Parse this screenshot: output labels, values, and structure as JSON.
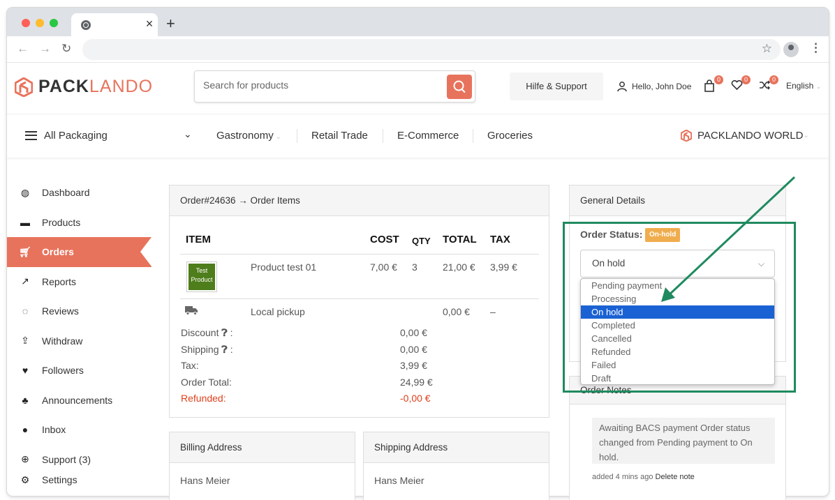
{
  "browser": {
    "tab_close": "×",
    "new_tab": "+"
  },
  "header": {
    "logo_text_dark": "PACK",
    "logo_text_accent": "LANDO",
    "search_placeholder": "Search for products",
    "support_label": "Hilfe & Support",
    "greeting": "Hello, John Doe",
    "cart_count": "0",
    "wishlist_count": "0",
    "compare_count": "0",
    "language": "English"
  },
  "categories": {
    "all_label": "All Packaging",
    "items": [
      "Gastronomy",
      "Retail Trade",
      "E-Commerce",
      "Groceries"
    ],
    "world_label": "PACKLANDO WORLD"
  },
  "sidebar": {
    "items": [
      {
        "label": "Dashboard",
        "icon": "dashboard-icon"
      },
      {
        "label": "Products",
        "icon": "briefcase-icon"
      },
      {
        "label": "Orders",
        "icon": "cart-icon"
      },
      {
        "label": "Reports",
        "icon": "chart-icon"
      },
      {
        "label": "Reviews",
        "icon": "comments-icon"
      },
      {
        "label": "Withdraw",
        "icon": "upload-icon"
      },
      {
        "label": "Followers",
        "icon": "heart-icon"
      },
      {
        "label": "Announcements",
        "icon": "bell-icon"
      },
      {
        "label": "Inbox",
        "icon": "chat-bubble-icon"
      },
      {
        "label": "Support (3)",
        "icon": "lifebuoy-icon"
      },
      {
        "label": "Settings",
        "icon": "gear-icon"
      }
    ]
  },
  "order": {
    "title": "Order#24636 → Order Items",
    "columns": {
      "item": "ITEM",
      "cost": "COST",
      "qty": "QTY",
      "total": "TOTAL",
      "tax": "TAX"
    },
    "product": {
      "image_text": "Test Product",
      "name": "Product test 01",
      "cost": "7,00 €",
      "qty": "3",
      "total": "21,00 €",
      "tax": "3,99 €"
    },
    "shipping_line": {
      "name": "Local pickup",
      "total": "0,00 €",
      "tax": "–"
    },
    "summary": [
      {
        "label": "Discount",
        "value": "0,00 €",
        "info": true
      },
      {
        "label": "Shipping",
        "value": "0,00 €",
        "info": true
      },
      {
        "label": "Tax:",
        "value": "3,99 €",
        "info": false
      },
      {
        "label": "Order Total:",
        "value": "24,99 €",
        "info": false
      },
      {
        "label": "Refunded:",
        "value": "-0,00 €",
        "info": false
      }
    ]
  },
  "billing": {
    "title": "Billing Address",
    "name": "Hans Meier"
  },
  "shipping": {
    "title": "Shipping Address",
    "name": "Hans Meier"
  },
  "general": {
    "title": "General Details",
    "status_label": "Order Status:",
    "status_badge": "On-hold",
    "selected": "On hold",
    "options": [
      "Pending payment",
      "Processing",
      "On hold",
      "Completed",
      "Cancelled",
      "Refunded",
      "Failed",
      "Draft"
    ]
  },
  "notes": {
    "title": "Order Notes",
    "text": "Awaiting BACS payment Order status changed from Pending payment to On hold.",
    "meta": "added 4 mins ago",
    "delete_label": "Delete note"
  },
  "colors": {
    "accent": "#e8735c",
    "highlight": "#1f8a5f",
    "badge": "#f0ad4e",
    "selected_option": "#1a62d3"
  }
}
